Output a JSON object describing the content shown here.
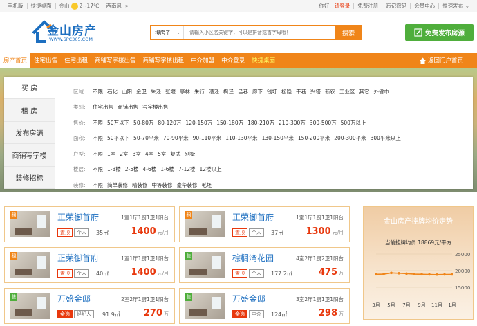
{
  "topbar": {
    "mobile": "手机版",
    "desktop": "快捷桌面",
    "city": "金山",
    "temp": "2~17℃",
    "wind": "西南风",
    "more": "»",
    "greeting": "你好,",
    "login": "请登录",
    "register": "免费注册",
    "forgot": "忘记密码",
    "member": "会员中心",
    "quick_publish": "快速发布",
    "arrow": "⌄"
  },
  "header": {
    "logo_name": "金山房产",
    "logo_url": "WWW.SPC365.COM",
    "search_category": "搜房子",
    "search_placeholder": "请输入小区名关键字，可以是拼音或首字母哦！",
    "search_button": "搜索",
    "publish_button": "免费发布房源"
  },
  "nav": {
    "items": [
      "房产首页",
      "住宅出售",
      "住宅出租",
      "商铺写字楼出售",
      "商铺写字楼出租",
      "中介加盟",
      "中介登录",
      "快捷桌面"
    ],
    "back": "返回门户首页"
  },
  "filter": {
    "tabs": [
      "买 房",
      "租 房",
      "发布房源",
      "商铺写字楼",
      "装修招标"
    ],
    "rows": [
      {
        "label": "区域:",
        "options": [
          "不限",
          "石化",
          "山阳",
          "金卫",
          "朱泾",
          "张堰",
          "亭林",
          "朱行",
          "漕泾",
          "枫泾",
          "吕巷",
          "廊下",
          "钱圩",
          "松隐",
          "干巷",
          "兴塔",
          "新农",
          "工业区",
          "其它",
          "外省市"
        ]
      },
      {
        "label": "类别:",
        "options": [
          "住宅出售",
          "商铺出售",
          "写字楼出售"
        ]
      },
      {
        "label": "售价:",
        "options": [
          "不限",
          "50万以下",
          "50-80万",
          "80-120万",
          "120-150万",
          "150-180万",
          "180-210万",
          "210-300万",
          "300-500万",
          "500万以上"
        ]
      },
      {
        "label": "面积:",
        "options": [
          "不限",
          "50平以下",
          "50-70平米",
          "70-90平米",
          "90-110平米",
          "110-130平米",
          "130-150平米",
          "150-200平米",
          "200-300平米",
          "300平米以上"
        ]
      },
      {
        "label": "户型:",
        "options": [
          "不限",
          "1室",
          "2室",
          "3室",
          "4室",
          "5室",
          "复式",
          "别墅"
        ]
      },
      {
        "label": "楼层:",
        "options": [
          "不限",
          "1-3楼",
          "2-5楼",
          "4-6楼",
          "1-6楼",
          "7-12楼",
          "12楼以上"
        ]
      },
      {
        "label": "装修:",
        "options": [
          "不限",
          "简单装修",
          "精装修",
          "中等装修",
          "豪华装修",
          "毛坯"
        ]
      }
    ]
  },
  "listings": [
    {
      "tag": "租",
      "tag_color": "#f08519",
      "title": "正荣御首府",
      "info": "1室1厅1厨1卫1阳台",
      "badge1": "置顶",
      "badge1_color": "#e8380d",
      "badge2": "个人",
      "area": "35㎡",
      "price": "1400",
      "unit": "元/月"
    },
    {
      "tag": "租",
      "tag_color": "#f08519",
      "title": "正荣御首府",
      "info": "1室1厅1厨1卫1阳台",
      "badge1": "置顶",
      "badge1_color": "#e8380d",
      "badge2": "个人",
      "area": "37㎡",
      "price": "1300",
      "unit": "元/月"
    },
    {
      "tag": "租",
      "tag_color": "#f08519",
      "title": "正荣御首府",
      "info": "1室1厅1厨1卫1阳台",
      "badge1": "置顶",
      "badge1_color": "#e8380d",
      "badge2": "个人",
      "area": "40㎡",
      "price": "1400",
      "unit": "元/月"
    },
    {
      "tag": "售",
      "tag_color": "#4fae3c",
      "title": "棕榈湾花园",
      "info": "4室2厅1厨2卫1阳台",
      "badge1": "置顶",
      "badge1_color": "#e8380d",
      "badge2": "个人",
      "area": "177.2㎡",
      "price": "475",
      "unit": "万"
    },
    {
      "tag": "售",
      "tag_color": "#4fae3c",
      "title": "万盛金邸",
      "info": "2室2厅1厨1卫1阳台",
      "badge1": "金选",
      "badge1_color": "#e8380d",
      "badge2": "经纪人",
      "area": "91.9㎡",
      "price": "270",
      "unit": "万"
    },
    {
      "tag": "售",
      "tag_color": "#4fae3c",
      "title": "万盛金邸",
      "info": "3室2厅1厨1卫1阳台",
      "badge1": "金选",
      "badge1_color": "#e8380d",
      "badge2": "中介",
      "area": "124㎡",
      "price": "298",
      "unit": "万"
    }
  ],
  "trend": {
    "title": "金山房产挂牌均价走势",
    "subtitle": "当前挂牌均价 18869元/平方"
  },
  "chart_data": {
    "type": "line",
    "x": [
      "3月",
      "4月",
      "5月",
      "6月",
      "7月",
      "8月",
      "9月",
      "10月",
      "11月",
      "12月",
      "1月"
    ],
    "xticks": [
      "3月",
      "5月",
      "7月",
      "9月",
      "11月",
      "1月"
    ],
    "values": [
      18900,
      18950,
      19300,
      19200,
      19100,
      18950,
      18900,
      18850,
      18800,
      18850,
      18869
    ],
    "yticks": [
      25000,
      20000,
      15000
    ],
    "ylim": [
      15000,
      25000
    ],
    "color": "#f08519"
  }
}
